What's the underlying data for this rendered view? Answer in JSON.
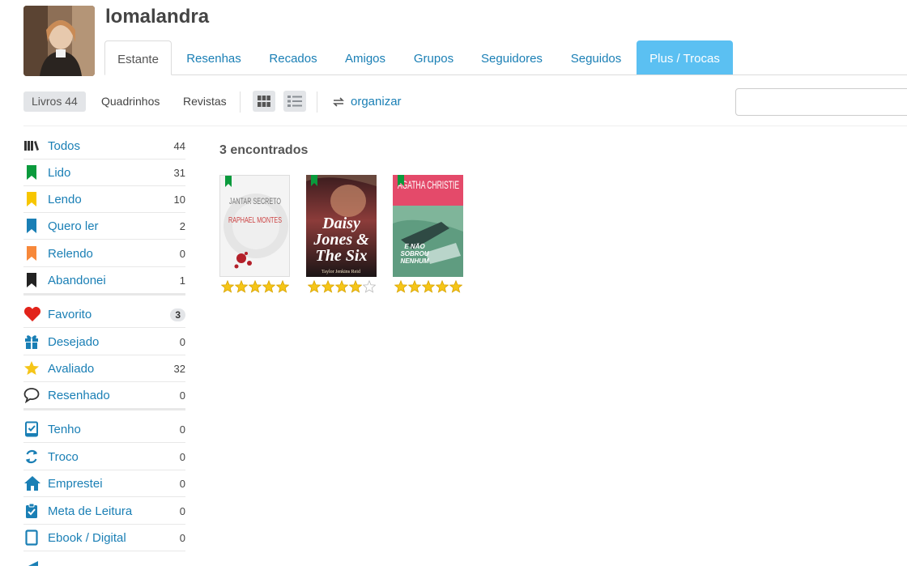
{
  "profile": {
    "username": "lomalandra"
  },
  "tabs": [
    {
      "label": "Estante"
    },
    {
      "label": "Resenhas"
    },
    {
      "label": "Recados"
    },
    {
      "label": "Amigos"
    },
    {
      "label": "Grupos"
    },
    {
      "label": "Seguidores"
    },
    {
      "label": "Seguidos"
    },
    {
      "label": "Plus / Trocas"
    }
  ],
  "subtabs": [
    {
      "label": "Livros 44"
    },
    {
      "label": "Quadrinhos"
    },
    {
      "label": "Revistas"
    }
  ],
  "toolbar": {
    "organize_label": "organizar"
  },
  "sidebar": {
    "items": [
      {
        "label": "Todos",
        "count": "44",
        "icon": "books-icon"
      },
      {
        "label": "Lido",
        "count": "31",
        "icon": "bookmark-green-icon"
      },
      {
        "label": "Lendo",
        "count": "10",
        "icon": "bookmark-yellow-icon"
      },
      {
        "label": "Quero ler",
        "count": "2",
        "icon": "bookmark-blue-icon"
      },
      {
        "label": "Relendo",
        "count": "0",
        "icon": "bookmark-orange-icon"
      },
      {
        "label": "Abandonei",
        "count": "1",
        "icon": "bookmark-black-icon"
      },
      {
        "label": "Favorito",
        "count": "3",
        "icon": "heart-icon"
      },
      {
        "label": "Desejado",
        "count": "0",
        "icon": "gift-icon"
      },
      {
        "label": "Avaliado",
        "count": "32",
        "icon": "star-icon"
      },
      {
        "label": "Resenhado",
        "count": "0",
        "icon": "speech-bubble-icon"
      },
      {
        "label": "Tenho",
        "count": "0",
        "icon": "check-book-icon"
      },
      {
        "label": "Troco",
        "count": "0",
        "icon": "exchange-icon"
      },
      {
        "label": "Emprestei",
        "count": "0",
        "icon": "house-icon"
      },
      {
        "label": "Meta de Leitura",
        "count": "0",
        "icon": "clipboard-check-icon"
      },
      {
        "label": "Ebook / Digital",
        "count": "0",
        "icon": "tablet-icon"
      }
    ]
  },
  "results": {
    "found_label": "3 encontrados"
  },
  "books": [
    {
      "cover_title": "JANTAR SECRETO",
      "cover_author": "RAPHAEL MONTES",
      "rating": 5
    },
    {
      "cover_title": "Daisy Jones & The Six",
      "cover_author": "Taylor Jenkins Reid",
      "rating": 4
    },
    {
      "cover_title": "E NÃO SOBROU NENHUM",
      "cover_author": "AGATHA CHRISTIE",
      "rating": 5
    }
  ],
  "colors": {
    "link": "#1a7fb5",
    "plus_tab": "#5bc0f2",
    "star": "#f5c518",
    "lido": "#0a9a3c",
    "lendo": "#f7c600",
    "quero_ler": "#1a7fb5",
    "relendo": "#f7883a",
    "abandonei": "#222222",
    "heart": "#e2231a"
  }
}
